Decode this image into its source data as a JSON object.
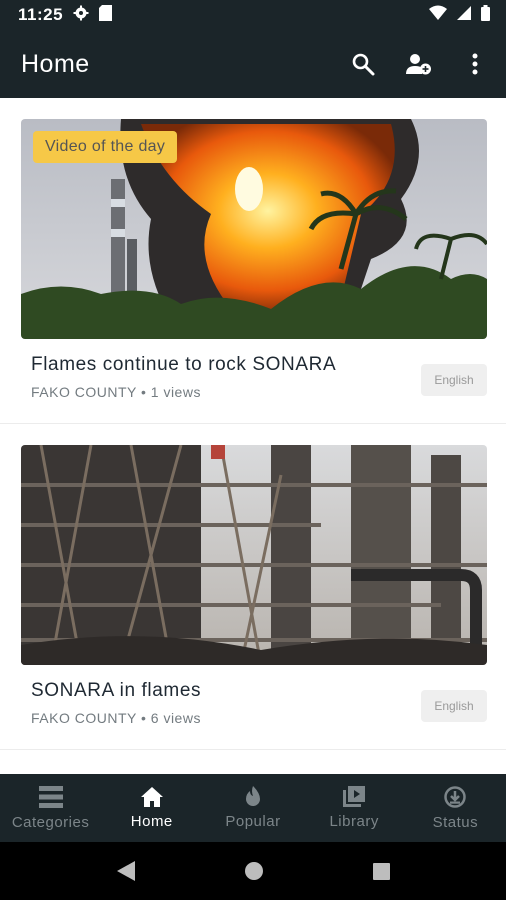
{
  "status_bar": {
    "time": "11:25"
  },
  "app_bar": {
    "title": "Home"
  },
  "videos": [
    {
      "badge": "Video of the day",
      "title": "Flames continue to rock SONARA",
      "meta": "FAKO COUNTY • 1 views",
      "language": "English"
    },
    {
      "title": "SONARA in flames",
      "meta": "FAKO COUNTY • 6 views",
      "language": "English"
    }
  ],
  "bottom_nav": [
    {
      "label": "Categories",
      "icon": "categories-icon"
    },
    {
      "label": "Home",
      "icon": "home-icon",
      "active": true
    },
    {
      "label": "Popular",
      "icon": "flame-icon"
    },
    {
      "label": "Library",
      "icon": "library-icon"
    },
    {
      "label": "Status",
      "icon": "download-status-icon"
    }
  ],
  "colors": {
    "bar": "#1b2529",
    "badge": "#f6c847",
    "active": "#ffffff",
    "inactive": "#7c8589"
  }
}
